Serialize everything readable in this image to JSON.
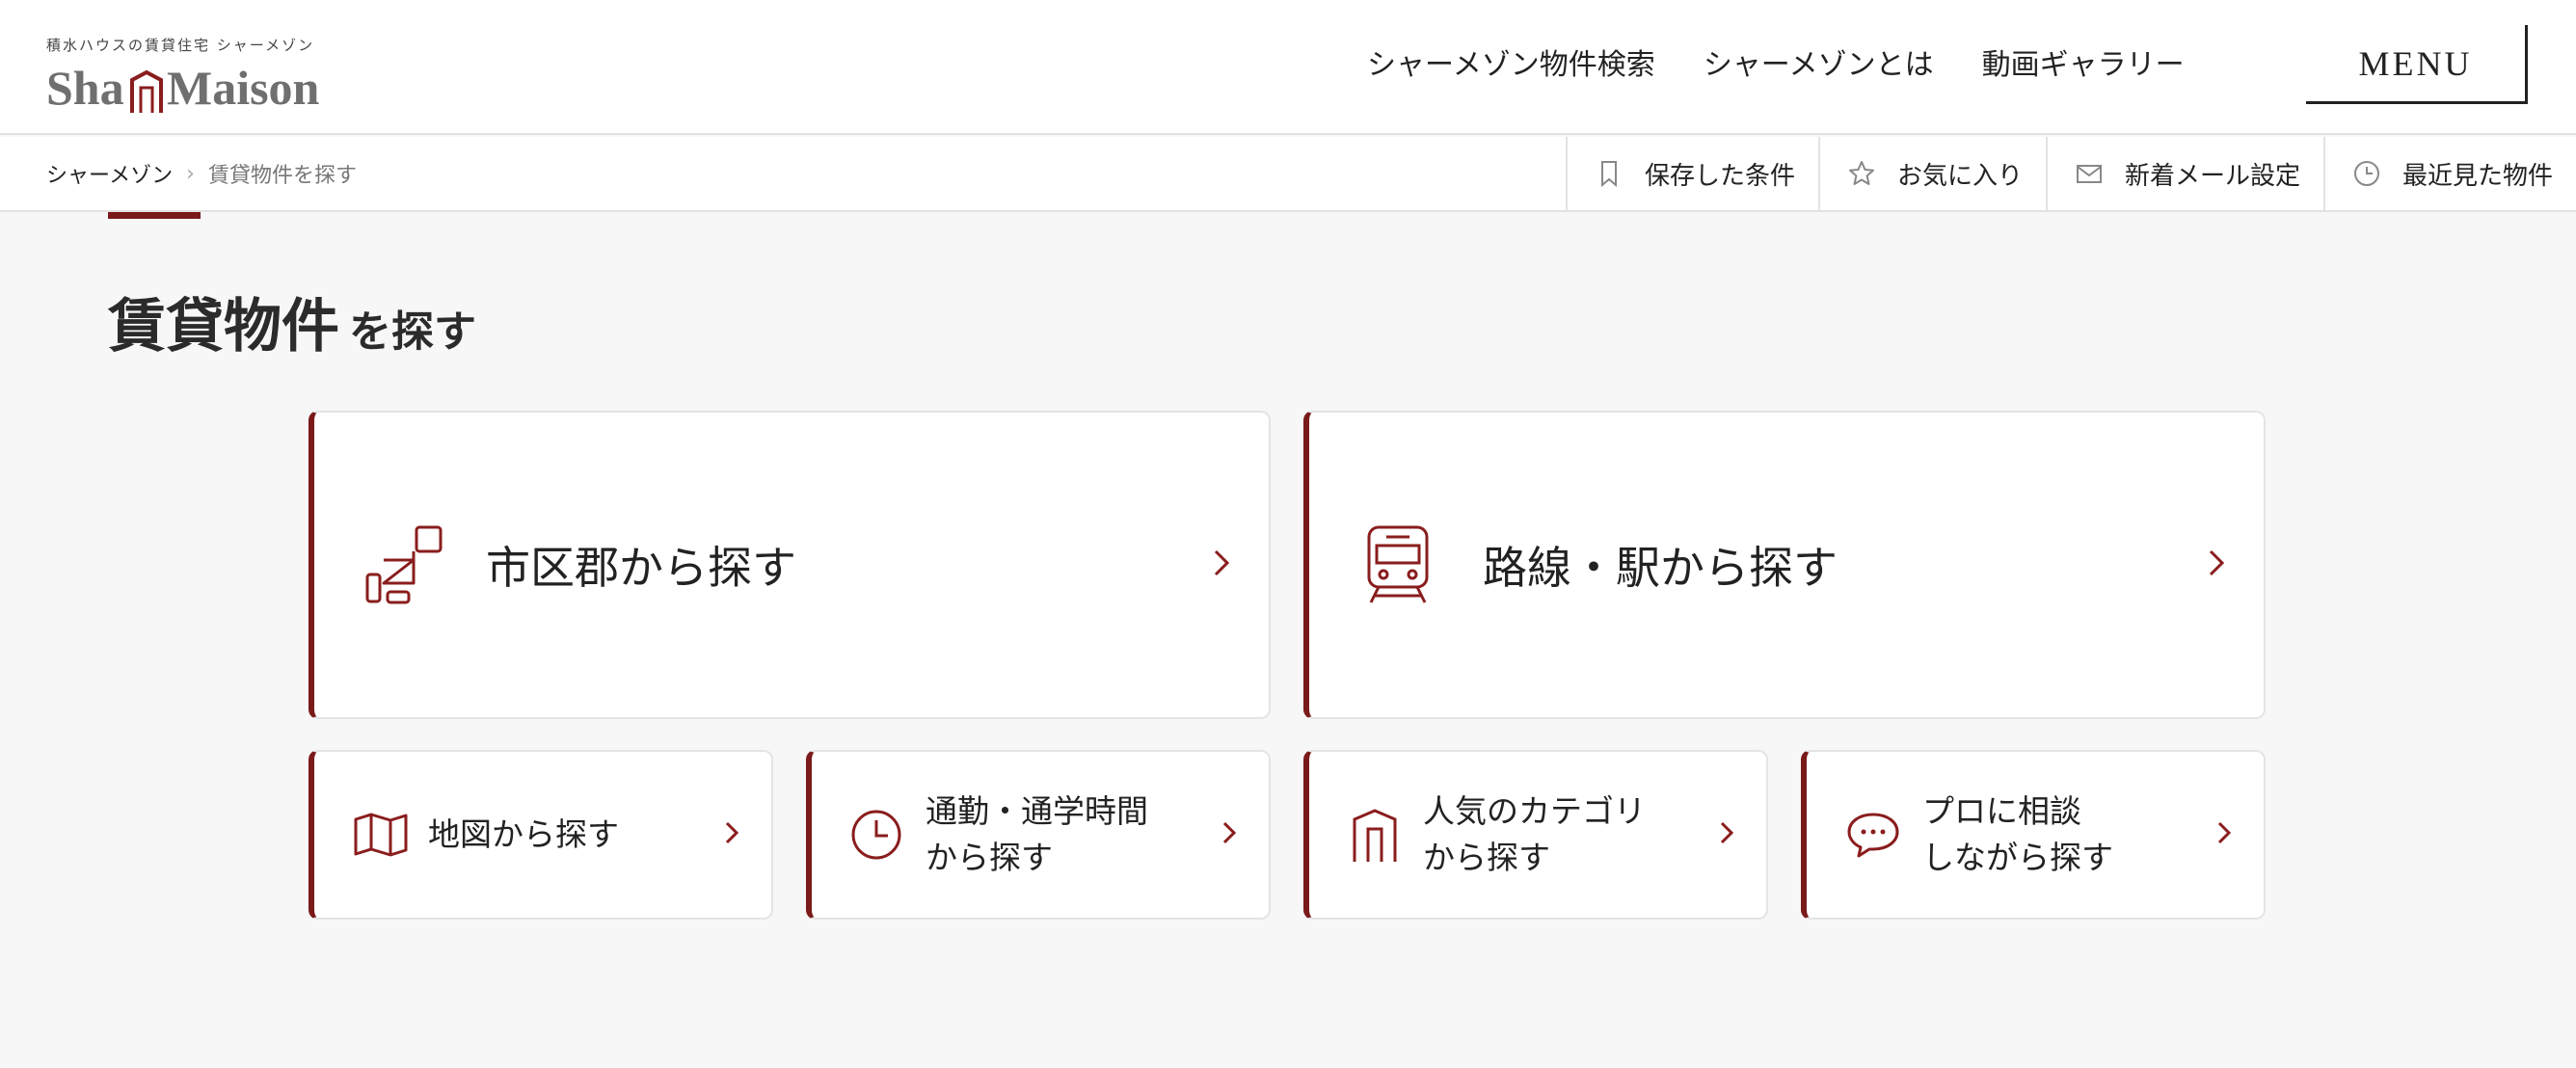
{
  "header": {
    "logo_tagline": "積水ハウスの賃貸住宅 シャーメゾン",
    "logo_word1": "Sha",
    "logo_word2": "Maison",
    "nav": [
      "シャーメゾン物件検索",
      "シャーメゾンとは",
      "動画ギャラリー"
    ],
    "menu_label": "MENU"
  },
  "breadcrumb": {
    "home": "シャーメゾン",
    "separator": "›",
    "current": "賃貸物件を探す"
  },
  "tools": [
    {
      "label": "保存した条件",
      "icon": "bookmark-icon"
    },
    {
      "label": "お気に入り",
      "icon": "star-icon"
    },
    {
      "label": "新着メール設定",
      "icon": "mail-icon"
    },
    {
      "label": "最近見た物件",
      "icon": "clock-icon"
    }
  ],
  "page": {
    "title_main": "賃貸物件",
    "title_sub": "を探す"
  },
  "big_cards": [
    {
      "label": "市区郡から探す",
      "icon": "area-blocks-icon"
    },
    {
      "label": "路線・駅から探す",
      "icon": "train-icon"
    }
  ],
  "small_cards": [
    {
      "line1": "地図から探す",
      "line2": "",
      "icon": "map-icon"
    },
    {
      "line1": "通勤・通学時間",
      "line2": "から探す",
      "icon": "clock-icon"
    },
    {
      "line1": "人気のカテゴリ",
      "line2": "から探す",
      "icon": "category-house-icon"
    },
    {
      "line1": "プロに相談",
      "line2": "しながら探す",
      "icon": "chat-bubble-icon"
    }
  ],
  "colors": {
    "accent": "#7a1a1a",
    "background": "#f7f7f7",
    "text": "#222222"
  }
}
